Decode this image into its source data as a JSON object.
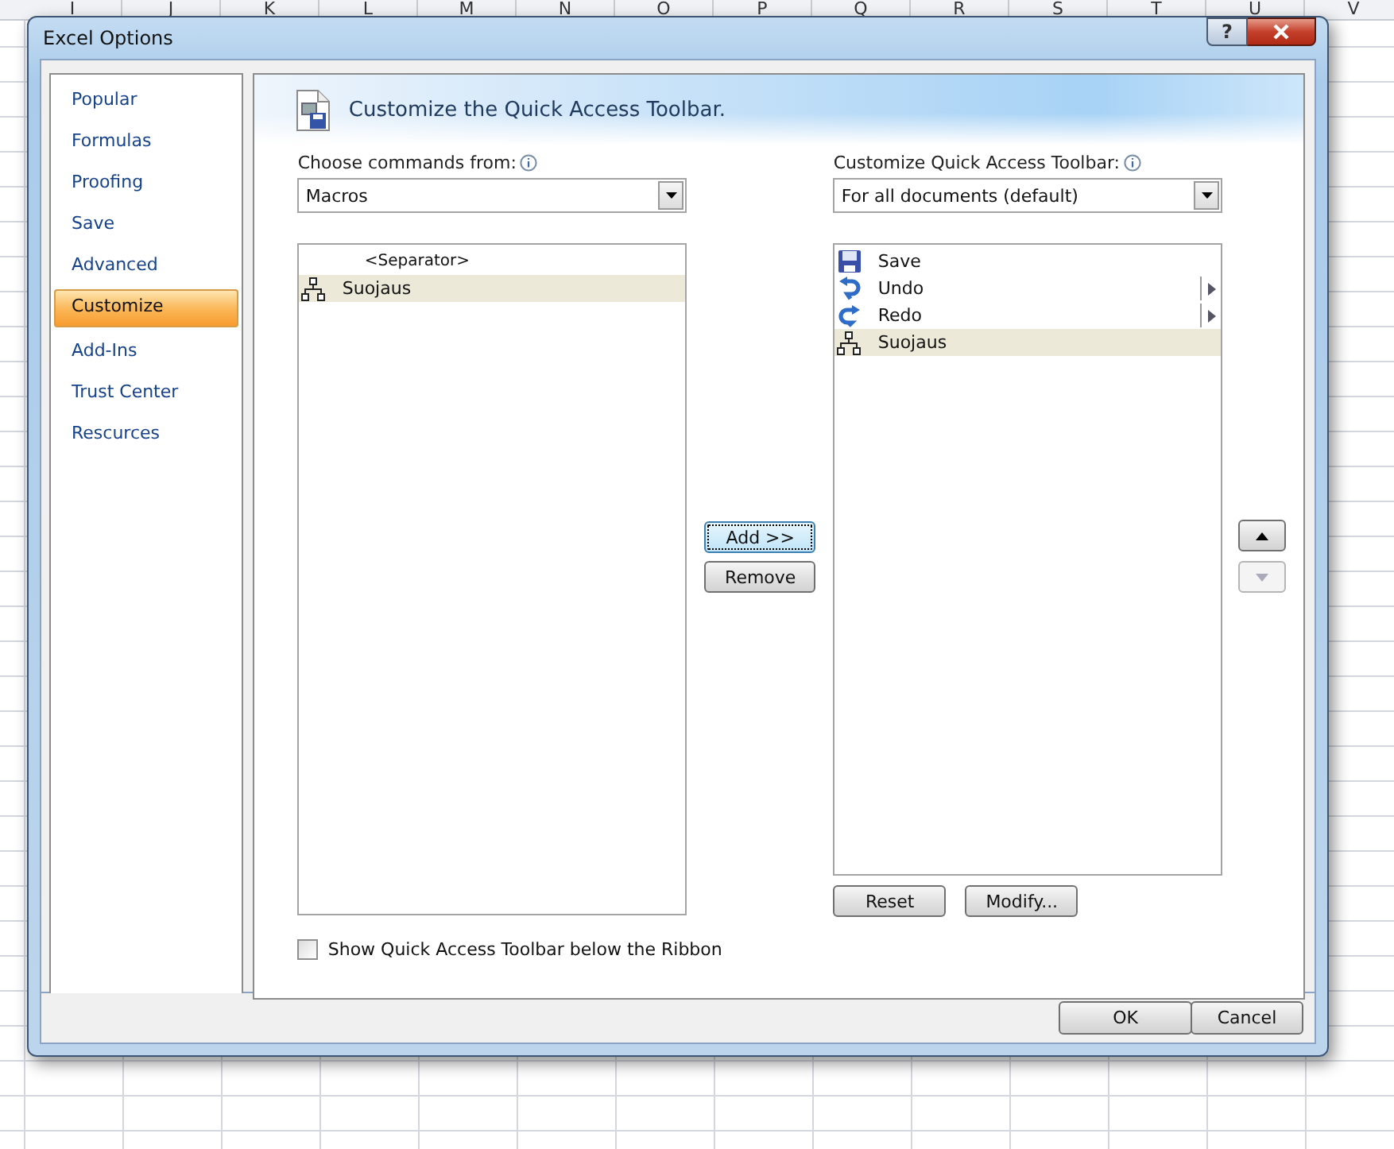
{
  "sheet": {
    "columns": [
      "I",
      "J",
      "K",
      "L",
      "M",
      "N",
      "O",
      "P",
      "Q",
      "R",
      "S",
      "T",
      "U",
      "V"
    ]
  },
  "window": {
    "title": "Excel Options",
    "help": "?"
  },
  "sidebar": {
    "items": [
      {
        "label": "Popular",
        "selected": false
      },
      {
        "label": "Formulas",
        "selected": false
      },
      {
        "label": "Proofing",
        "selected": false
      },
      {
        "label": "Save",
        "selected": false
      },
      {
        "label": "Advanced",
        "selected": false
      },
      {
        "label": "Customize",
        "selected": true
      },
      {
        "label": "Add-Ins",
        "selected": false
      },
      {
        "label": "Trust Center",
        "selected": false
      },
      {
        "label": "Rescurces",
        "selected": false
      }
    ]
  },
  "header": {
    "title": "Customize the Quick Access Toolbar."
  },
  "choose": {
    "label": "Choose commands from:",
    "value": "Macros"
  },
  "customize": {
    "label": "Customize Quick Access Toolbar:",
    "value": "For all documents (default)"
  },
  "commands": [
    {
      "kind": "separator",
      "label": "<Separator>",
      "selected": false
    },
    {
      "kind": "macro",
      "label": "Suojaus",
      "selected": true
    }
  ],
  "toolbar_items": [
    {
      "kind": "save",
      "label": "Save",
      "submenu": false,
      "selected": false
    },
    {
      "kind": "undo",
      "label": "Undo",
      "submenu": true,
      "selected": false
    },
    {
      "kind": "redo",
      "label": "Redo",
      "submenu": true,
      "selected": false
    },
    {
      "kind": "macro",
      "label": "Suojaus",
      "submenu": false,
      "selected": true
    }
  ],
  "middle_buttons": [
    {
      "label": "Add >>",
      "focused": true
    },
    {
      "label": "Remove",
      "focused": false
    }
  ],
  "move_buttons": [
    {
      "kind": "up",
      "disabled": false
    },
    {
      "kind": "down",
      "disabled": true
    }
  ],
  "list_buttons": [
    {
      "label": "Reset"
    },
    {
      "label": "Modify..."
    }
  ],
  "show_below": {
    "label": "Show Quick Access Toolbar below the Ribbon",
    "checked": false
  },
  "buttons": [
    "OK",
    "Cancel"
  ]
}
